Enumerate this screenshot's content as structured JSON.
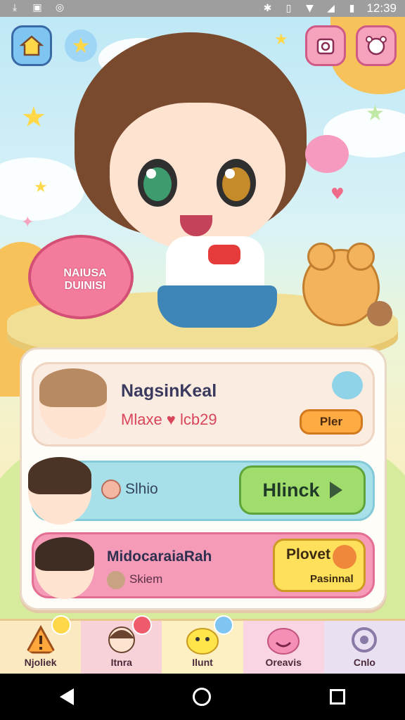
{
  "status_bar": {
    "time": "12:39",
    "left_icons": [
      "download-icon",
      "sim-icon",
      "sync-icon"
    ],
    "right_icons": [
      "bluetooth-icon",
      "vibrate-icon",
      "wifi-icon",
      "signal-icon",
      "battery-icon"
    ]
  },
  "scene": {
    "sign_text": "NAIUSA DUINISI",
    "top_left_buttons": [
      "home-icon",
      "star-icon"
    ],
    "top_right_buttons": [
      "camera-icon",
      "character-icon"
    ]
  },
  "cards": {
    "card1": {
      "title": "NagsinKeal",
      "subtitle": "Mlaxe ♥ lcb29",
      "button": "Pler"
    },
    "card2": {
      "label": "Slhio",
      "button": "Hlinck"
    },
    "card3": {
      "title": "MidocaraiaRah",
      "subtitle": "Skiem",
      "button_top": "Plovet",
      "button_bottom": "Pasinnal"
    }
  },
  "bottom_nav": [
    {
      "label": "Njoliek",
      "icon": "alert-icon"
    },
    {
      "label": "Itnra",
      "icon": "profile-icon"
    },
    {
      "label": "Ilunt",
      "icon": "pet-icon"
    },
    {
      "label": "Oreavis",
      "icon": "friends-icon"
    },
    {
      "label": "Cnlo",
      "icon": "settings-icon"
    }
  ],
  "colors": {
    "panel_bg": "#fffdf8",
    "card1_bg": "#fbece2",
    "card2_bg": "#a8e0ea",
    "card3_bg": "#f59bb7",
    "play_button": "#a0dd6d",
    "orange_button": "#ffab43",
    "yellow_button": "#ffe05a"
  }
}
